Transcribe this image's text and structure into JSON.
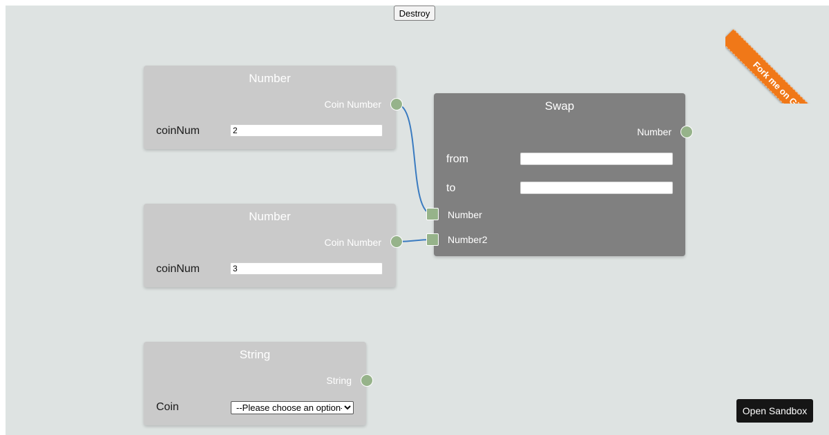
{
  "toolbar": {
    "destroy_label": "Destroy"
  },
  "ribbon": {
    "label": "Fork me on GitHub",
    "color": "#f07818"
  },
  "sandbox": {
    "label": "Open Sandbox"
  },
  "colors": {
    "canvas_bg": "#dee3e2",
    "node_bg": "#cacaca",
    "node_selected_bg": "#808080",
    "socket": "#96b38a",
    "connection": "#3a7bc0"
  },
  "nodes": {
    "number1": {
      "title": "Number",
      "output_label": "Coin Number",
      "field_label": "coinNum",
      "field_value": "2"
    },
    "number2": {
      "title": "Number",
      "output_label": "Coin Number",
      "field_label": "coinNum",
      "field_value": "3"
    },
    "string1": {
      "title": "String",
      "output_label": "String",
      "field_label": "Coin",
      "select_value": "--Please choose an option--"
    },
    "swap": {
      "title": "Swap",
      "output_label": "Number",
      "from_label": "from",
      "from_value": "",
      "to_label": "to",
      "to_value": "",
      "input1_label": "Number",
      "input2_label": "Number2"
    }
  }
}
